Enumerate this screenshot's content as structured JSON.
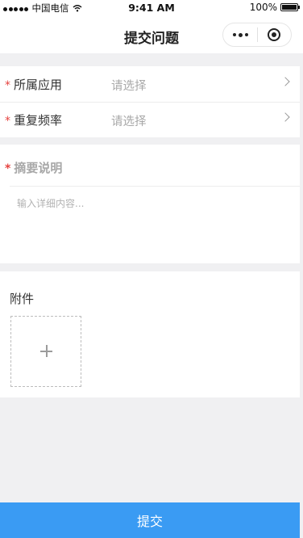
{
  "status": {
    "carrier": "中国电信",
    "time": "9:41 AM",
    "battery": "100%"
  },
  "nav": {
    "title": "提交问题",
    "more_icon": "more-dots-icon",
    "close_icon": "target-close-icon"
  },
  "form": {
    "app_field": {
      "label": "所属应用",
      "value": "请选择"
    },
    "frequency_field": {
      "label": "重复频率",
      "value": "请选择"
    },
    "summary": {
      "label": "摘要说明",
      "placeholder": "输入详细内容..."
    },
    "attachment": {
      "label": "附件",
      "add_icon": "plus-icon"
    },
    "required_mark": "*"
  },
  "actions": {
    "submit_label": "提交"
  },
  "colors": {
    "accent": "#3a9bf3",
    "required": "#e64340",
    "placeholder": "#a8a8a8",
    "background": "#f0f0f2"
  }
}
